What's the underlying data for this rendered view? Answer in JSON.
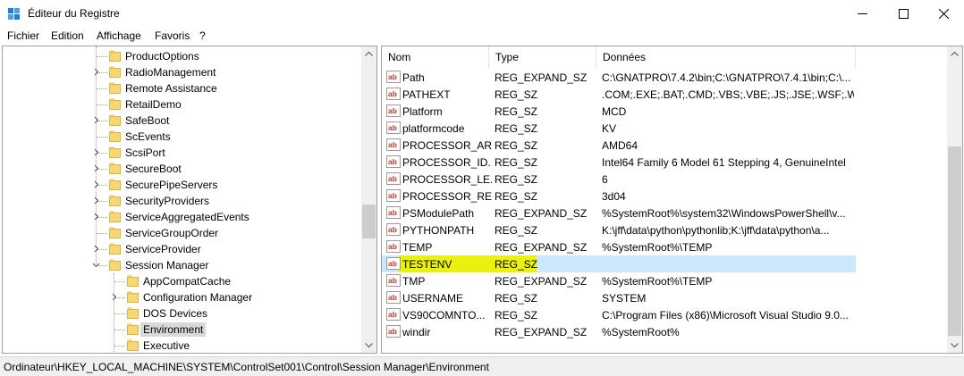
{
  "window": {
    "title": "Éditeur du Registre",
    "icon": "registry-editor-icon"
  },
  "menu": [
    "Fichier",
    "Edition",
    "Affichage",
    "Favoris",
    "?"
  ],
  "tree": {
    "items": [
      {
        "label": "ProductOptions",
        "expander": "none",
        "level": 1
      },
      {
        "label": "RadioManagement",
        "expander": "collapsed",
        "level": 1
      },
      {
        "label": "Remote Assistance",
        "expander": "none",
        "level": 1
      },
      {
        "label": "RetailDemo",
        "expander": "none",
        "level": 1
      },
      {
        "label": "SafeBoot",
        "expander": "collapsed",
        "level": 1
      },
      {
        "label": "ScEvents",
        "expander": "none",
        "level": 1
      },
      {
        "label": "ScsiPort",
        "expander": "collapsed",
        "level": 1
      },
      {
        "label": "SecureBoot",
        "expander": "collapsed",
        "level": 1
      },
      {
        "label": "SecurePipeServers",
        "expander": "collapsed",
        "level": 1
      },
      {
        "label": "SecurityProviders",
        "expander": "collapsed",
        "level": 1
      },
      {
        "label": "ServiceAggregatedEvents",
        "expander": "collapsed",
        "level": 1
      },
      {
        "label": "ServiceGroupOrder",
        "expander": "none",
        "level": 1
      },
      {
        "label": "ServiceProvider",
        "expander": "collapsed",
        "level": 1
      },
      {
        "label": "Session Manager",
        "expander": "expanded",
        "level": 1
      },
      {
        "label": "AppCompatCache",
        "expander": "none",
        "level": 2
      },
      {
        "label": "Configuration Manager",
        "expander": "collapsed",
        "level": 2
      },
      {
        "label": "DOS Devices",
        "expander": "none",
        "level": 2
      },
      {
        "label": "Environment",
        "expander": "none",
        "level": 2,
        "selected": true
      },
      {
        "label": "Executive",
        "expander": "none",
        "level": 2
      }
    ]
  },
  "list": {
    "columns": [
      "Nom",
      "Type",
      "Données"
    ],
    "rows": [
      {
        "name": "Path",
        "type": "REG_EXPAND_SZ",
        "data": "C:\\GNATPRO\\7.4.2\\bin;C:\\GNATPRO\\7.4.1\\bin;C:\\..."
      },
      {
        "name": "PATHEXT",
        "type": "REG_SZ",
        "data": ".COM;.EXE;.BAT;.CMD;.VBS;.VBE;.JS;.JSE;.WSF;.WS..."
      },
      {
        "name": "Platform",
        "type": "REG_SZ",
        "data": "MCD"
      },
      {
        "name": "platformcode",
        "type": "REG_SZ",
        "data": "KV"
      },
      {
        "name": "PROCESSOR_AR...",
        "type": "REG_SZ",
        "data": "AMD64"
      },
      {
        "name": "PROCESSOR_ID...",
        "type": "REG_SZ",
        "data": "Intel64 Family 6 Model 61 Stepping 4, GenuineIntel"
      },
      {
        "name": "PROCESSOR_LE...",
        "type": "REG_SZ",
        "data": "6"
      },
      {
        "name": "PROCESSOR_RE...",
        "type": "REG_SZ",
        "data": "3d04"
      },
      {
        "name": "PSModulePath",
        "type": "REG_EXPAND_SZ",
        "data": "%SystemRoot%\\system32\\WindowsPowerShell\\v..."
      },
      {
        "name": "PYTHONPATH",
        "type": "REG_SZ",
        "data": "K:\\jff\\data\\python\\pythonlib;K:\\jff\\data\\python\\a..."
      },
      {
        "name": "TEMP",
        "type": "REG_EXPAND_SZ",
        "data": "%SystemRoot%\\TEMP"
      },
      {
        "name": "TESTENV",
        "type": "REG_SZ",
        "data": "",
        "selected": true,
        "highlighted": true
      },
      {
        "name": "TMP",
        "type": "REG_EXPAND_SZ",
        "data": "%SystemRoot%\\TEMP"
      },
      {
        "name": "USERNAME",
        "type": "REG_SZ",
        "data": "SYSTEM"
      },
      {
        "name": "VS90COMNTO...",
        "type": "REG_SZ",
        "data": "C:\\Program Files (x86)\\Microsoft Visual Studio 9.0..."
      },
      {
        "name": "windir",
        "type": "REG_EXPAND_SZ",
        "data": "%SystemRoot%"
      }
    ]
  },
  "status": {
    "path": "Ordinateur\\HKEY_LOCAL_MACHINE\\SYSTEM\\ControlSet001\\Control\\Session Manager\\Environment"
  },
  "colors": {
    "selection": "#cce8ff",
    "highlight": "#eaf10e",
    "tree_selection": "#d9d9d9",
    "folder": "#f8d775"
  }
}
